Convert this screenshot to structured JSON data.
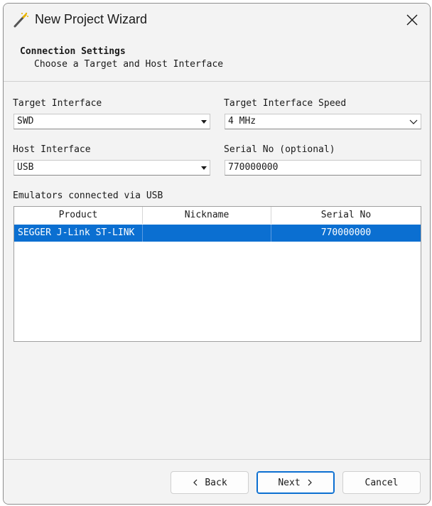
{
  "window": {
    "title": "New Project Wizard",
    "icon": "magic-wand-icon"
  },
  "header": {
    "title": "Connection Settings",
    "subtitle": "Choose a Target and Host Interface"
  },
  "form": {
    "target_interface_label": "Target Interface",
    "target_interface_value": "SWD",
    "target_speed_label": "Target Interface Speed",
    "target_speed_value": "4 MHz",
    "host_interface_label": "Host Interface",
    "host_interface_value": "USB",
    "serial_label": "Serial No (optional)",
    "serial_value": "770000000"
  },
  "emulators": {
    "label": "Emulators connected via USB",
    "columns": [
      "Product",
      "Nickname",
      "Serial No"
    ],
    "rows": [
      {
        "product": "SEGGER J-Link ST-LINK",
        "nickname": "",
        "serial": "770000000"
      }
    ]
  },
  "buttons": {
    "back": "Back",
    "next": "Next",
    "cancel": "Cancel"
  }
}
